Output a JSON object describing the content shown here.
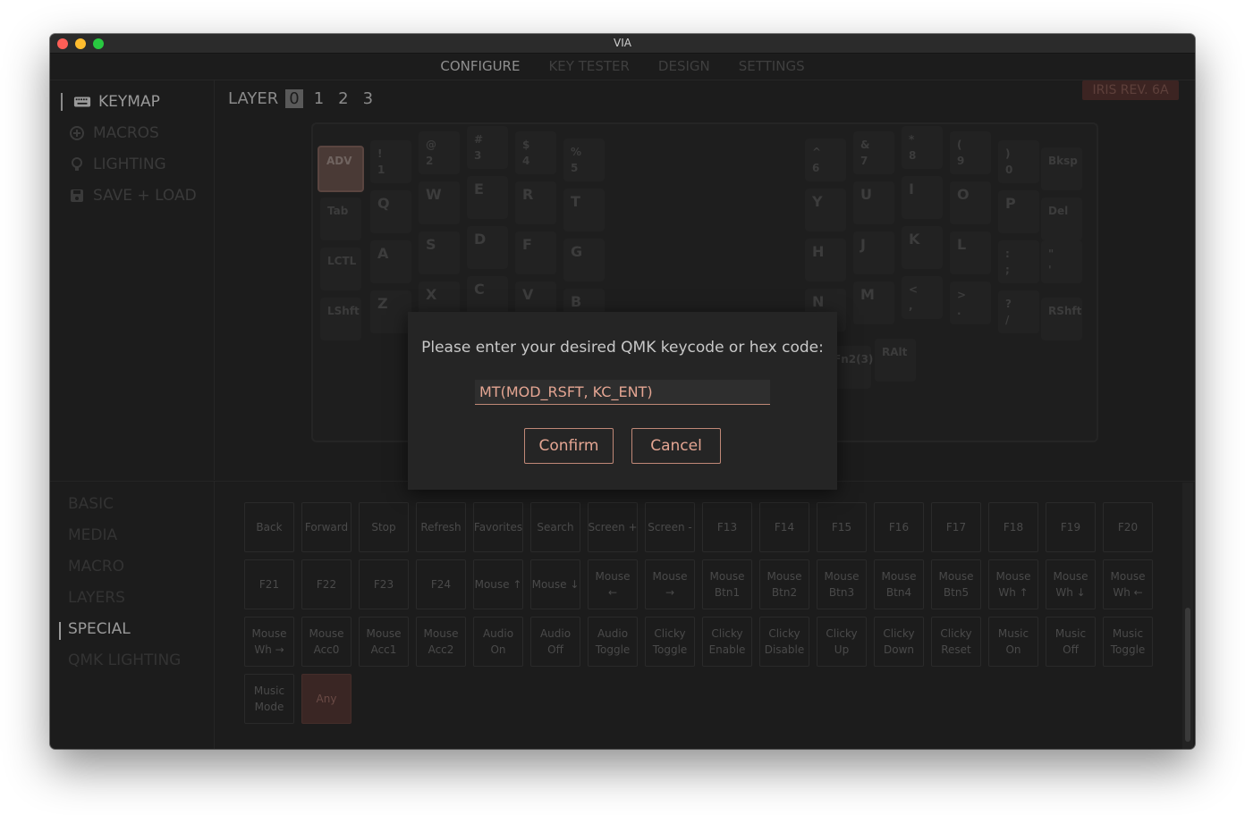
{
  "window": {
    "title": "VIA"
  },
  "nav": [
    "CONFIGURE",
    "KEY TESTER",
    "DESIGN",
    "SETTINGS"
  ],
  "sidebar": [
    {
      "label": "KEYMAP",
      "icon": "keyboard-icon"
    },
    {
      "label": "MACROS",
      "icon": "plus-circle-icon"
    },
    {
      "label": "LIGHTING",
      "icon": "bulb-icon"
    },
    {
      "label": "SAVE + LOAD",
      "icon": "save-icon"
    }
  ],
  "layer": {
    "label": "LAYER",
    "numbers": [
      "0",
      "1",
      "2",
      "3"
    ],
    "selected": "0"
  },
  "badge": "IRIS REV. 6A",
  "keys": [
    "ADV",
    "!\n1",
    "@\n2",
    "#\n3",
    "$\n4",
    "%\n5",
    "Tab",
    "Q",
    "W",
    "E",
    "R",
    "T",
    "LCTL",
    "A",
    "S",
    "D",
    "F",
    "G",
    "LShft",
    "Z",
    "X",
    "C",
    "V",
    "B",
    "^\n6",
    "&\n7",
    "*\n8",
    "(\n9",
    ")\n0",
    "Bksp",
    "Y",
    "U",
    "I",
    "O",
    "P",
    "Del",
    "H",
    "J",
    "K",
    "L",
    ":\n;",
    "\"\n'",
    "N",
    "M",
    "<\n,",
    ">\n.",
    "?\n/",
    "RShft",
    "Fn2(3)",
    "RAlt"
  ],
  "kc_tabs": [
    "BASIC",
    "MEDIA",
    "MACRO",
    "LAYERS",
    "SPECIAL",
    "QMK LIGHTING"
  ],
  "keycodes": [
    "Back",
    "Forward",
    "Stop",
    "Refresh",
    "Favorites",
    "Search",
    "Screen +",
    "Screen -",
    "F13",
    "F14",
    "F15",
    "F16",
    "F17",
    "F18",
    "F19",
    "F20",
    "F21",
    "F22",
    "F23",
    "F24",
    "Mouse ↑",
    "Mouse ↓",
    "Mouse\n←",
    "Mouse\n→",
    "Mouse\nBtn1",
    "Mouse\nBtn2",
    "Mouse\nBtn3",
    "Mouse\nBtn4",
    "Mouse\nBtn5",
    "Mouse\nWh ↑",
    "Mouse\nWh ↓",
    "Mouse\nWh ←",
    "Mouse\nWh →",
    "Mouse\nAcc0",
    "Mouse\nAcc1",
    "Mouse\nAcc2",
    "Audio\nOn",
    "Audio\nOff",
    "Audio\nToggle",
    "Clicky\nToggle",
    "Clicky\nEnable",
    "Clicky\nDisable",
    "Clicky\nUp",
    "Clicky\nDown",
    "Clicky\nReset",
    "Music\nOn",
    "Music\nOff",
    "Music\nToggle",
    "Music\nMode",
    "Any"
  ],
  "dialog": {
    "message": "Please enter your desired QMK keycode or hex code:",
    "value": "MT(MOD_RSFT, KC_ENT)",
    "confirm": "Confirm",
    "cancel": "Cancel"
  },
  "colors": {
    "accent": "#e4a592",
    "background": "#1c1c1c"
  }
}
